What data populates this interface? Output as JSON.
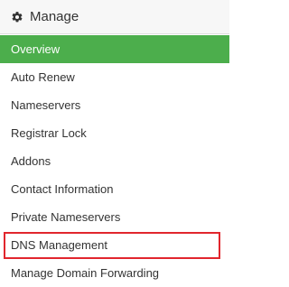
{
  "header": {
    "title": "Manage",
    "icon": "gear-icon"
  },
  "items": [
    {
      "label": "Overview",
      "active": true
    },
    {
      "label": "Auto Renew"
    },
    {
      "label": "Nameservers"
    },
    {
      "label": "Registrar Lock"
    },
    {
      "label": "Addons"
    },
    {
      "label": "Contact Information"
    },
    {
      "label": "Private Nameservers"
    },
    {
      "label": "DNS Management",
      "highlighted": true
    },
    {
      "label": "Manage Domain Forwarding"
    }
  ],
  "colors": {
    "active_bg": "#4cae4c",
    "highlight_border": "#e1262d",
    "text": "#333333"
  }
}
